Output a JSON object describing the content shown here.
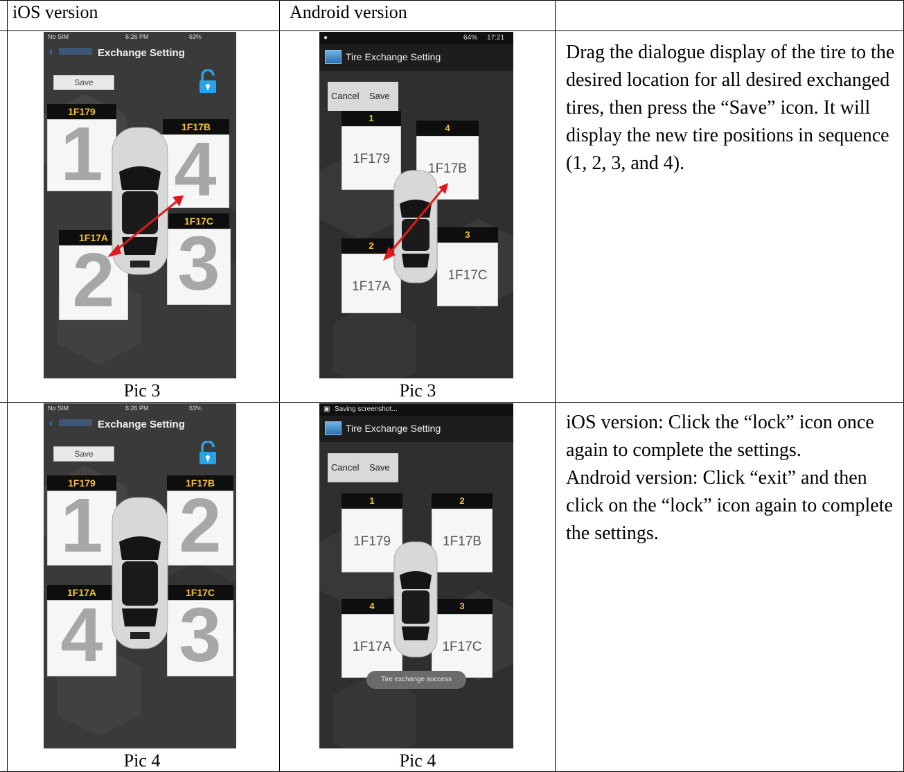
{
  "table": {
    "headers": [
      "iOS version",
      "Android version",
      ""
    ]
  },
  "rows": [
    {
      "ios_caption": "Pic 3",
      "android_caption": "Pic 3",
      "description": "Drag the dialogue display of the tire to the desired location for all desired exchanged tires, then press the “Save” icon. It will display the new tire positions in sequence (1, 2, 3, and 4).",
      "ios": {
        "status": {
          "carrier": "No SIM",
          "time": "6:26 PM",
          "battery": "63%"
        },
        "back_icon": "chevron-left-icon",
        "title": "Exchange Setting",
        "save_label": "Save",
        "lock_icon": "unlocked-padlock-icon",
        "tires": [
          {
            "id": "1F179",
            "number": "1"
          },
          {
            "id": "1F17B",
            "number": "4"
          },
          {
            "id": "1F17A",
            "number": "2"
          },
          {
            "id": "1F17C",
            "number": "3"
          }
        ]
      },
      "android": {
        "status": {
          "time": "17:21",
          "battery": "64%"
        },
        "title": "Tire Exchange Setting",
        "cancel_label": "Cancel",
        "save_label": "Save",
        "tires": [
          {
            "number": "1",
            "id": "1F179"
          },
          {
            "number": "4",
            "id": "1F17B"
          },
          {
            "number": "2",
            "id": "1F17A"
          },
          {
            "number": "3",
            "id": "1F17C"
          }
        ]
      }
    },
    {
      "ios_caption": "Pic 4",
      "android_caption": "Pic 4",
      "description_lines": [
        "iOS version: Click the “lock” icon once again to complete the settings.",
        "Android version: Click “exit” and then click on the “lock” icon again to complete the settings."
      ],
      "ios": {
        "status": {
          "carrier": "No SIM",
          "time": "6:26 PM",
          "battery": "63%"
        },
        "back_icon": "chevron-left-icon",
        "title": "Exchange Setting",
        "save_label": "Save",
        "lock_icon": "unlocked-padlock-icon",
        "tires": [
          {
            "id": "1F179",
            "number": "1"
          },
          {
            "id": "1F17B",
            "number": "2"
          },
          {
            "id": "1F17A",
            "number": "4"
          },
          {
            "id": "1F17C",
            "number": "3"
          }
        ]
      },
      "android": {
        "status": {
          "notification": "Saving screenshot..."
        },
        "title": "Tire Exchange Setting",
        "cancel_label": "Cancel",
        "save_label": "Save",
        "toast": "Tire exchange success",
        "tires": [
          {
            "number": "1",
            "id": "1F179"
          },
          {
            "number": "2",
            "id": "1F17B"
          },
          {
            "number": "4",
            "id": "1F17A"
          },
          {
            "number": "3",
            "id": "1F17C"
          }
        ]
      }
    }
  ],
  "colors": {
    "ios_blue": "#2f7fd8",
    "tire_label_text": "#f2c23a",
    "arrow_red": "#e01a1a"
  }
}
